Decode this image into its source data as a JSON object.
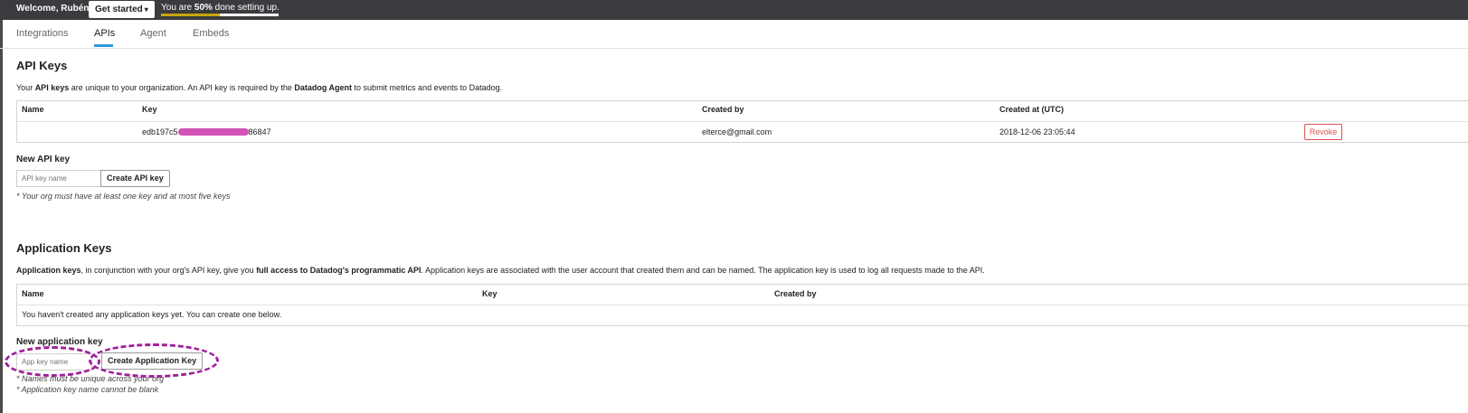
{
  "topbar": {
    "welcome": "Welcome, Rubén!",
    "get_started": "Get started",
    "progress_prefix": "You are ",
    "progress_percent": "50%",
    "progress_suffix": " done setting up.",
    "progress_value": 0.5,
    "progress_color": "#c9a400"
  },
  "tabs": [
    {
      "label": "Integrations",
      "active": false
    },
    {
      "label": "APIs",
      "active": true
    },
    {
      "label": "Agent",
      "active": false
    },
    {
      "label": "Embeds",
      "active": false
    }
  ],
  "api_keys": {
    "title": "API Keys",
    "desc_1": "Your ",
    "desc_bold_1": "API keys",
    "desc_2": " are unique to your organization. An API key is required by the ",
    "desc_bold_2": "Datadog Agent",
    "desc_3": " to submit metrics and events to Datadog.",
    "columns": [
      "Name",
      "Key",
      "Created by",
      "Created at (UTC)"
    ],
    "row": {
      "name": "",
      "key_start": "edb197c5",
      "key_end": "86847",
      "created_by": "elterce@gmail.com",
      "created_at": "2018-12-06 23:05:44",
      "revoke": "Revoke"
    },
    "new_title": "New API key",
    "input_placeholder": "API key name",
    "create_button": "Create API key",
    "note": "* Your org must have at least one key and at most five keys"
  },
  "app_keys": {
    "title": "Application Keys",
    "desc_bold_1": "Application keys",
    "desc_2": ", in conjunction with your org's API key, give you ",
    "desc_bold_2": "full access to Datadog's programmatic API",
    "desc_3": ". Application keys are associated with the user account that created them and can be named. The application key is used to log all requests made to the API.",
    "columns": [
      "Name",
      "Key",
      "Created by"
    ],
    "empty": "You haven't created any application keys yet. You can create one below.",
    "new_title": "New application key",
    "input_placeholder": "App key name",
    "create_button": "Create Application Key",
    "note_1": "* Names must be unique across your org",
    "note_2": "* Application key name cannot be blank"
  },
  "colors": {
    "topbar": "#3b3b3f",
    "tab_accent": "#2a9ad6",
    "revoke": "#d9534f",
    "annotation": "#a0209b"
  }
}
